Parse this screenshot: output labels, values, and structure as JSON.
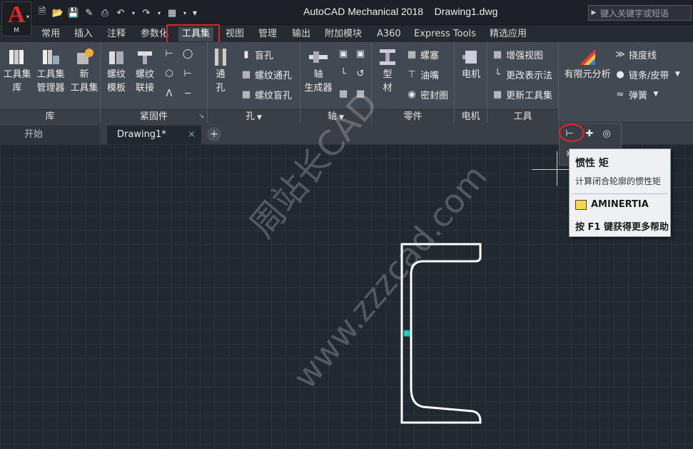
{
  "app": {
    "letter": "A",
    "sub": "M",
    "title": "AutoCAD Mechanical 2018    Drawing1.dwg"
  },
  "search": {
    "placeholder": "键入关键字或短语"
  },
  "ribbon_tabs": [
    "常用",
    "插入",
    "注释",
    "参数化",
    "工具集",
    "视图",
    "管理",
    "输出",
    "附加模块",
    "A360",
    "Express Tools",
    "精选应用"
  ],
  "active_tab": "工具集",
  "panels": {
    "lib": {
      "title": "库",
      "b1": "工具集",
      "b1b": "库",
      "b2": "工具集",
      "b2b": "管理器",
      "b3": "新",
      "b3b": "工具集"
    },
    "fast": {
      "title": "紧固件",
      "b1": "螺纹",
      "b1b": "模板",
      "b2": "螺纹",
      "b2b": "联接"
    },
    "hole": {
      "title": "孔",
      "b1": "通",
      "b1b": "孔",
      "s1": "盲孔",
      "s2": "螺纹通孔",
      "s3": "螺纹盲孔"
    },
    "shaft": {
      "title": "轴",
      "b1": "轴",
      "b1b": "生成器"
    },
    "parts": {
      "title": "零件",
      "b1": "型",
      "b1b": "材",
      "s1": "螺塞",
      "s2": "油嘴",
      "s3": "密封圈"
    },
    "motor": {
      "title": "电机",
      "b1": "电机"
    },
    "tools": {
      "title": "工具",
      "s1": "增强视图",
      "s2": "更改表示法",
      "s3": "更新工具集"
    },
    "calc": {
      "b1": "有限元分析",
      "s1": "挠度线",
      "s2": "链条/皮带",
      "s3": "弹簧"
    }
  },
  "doc_tabs": {
    "start": "开始",
    "current": "Drawing1*",
    "close": "×",
    "plus": "+"
  },
  "tooltip": {
    "title": "惯性 矩",
    "desc": "计算闭合轮廓的惯性矩",
    "command": "AMINERTIA",
    "help": "按 F1 键获得更多帮助"
  },
  "watermark": {
    "line1": "周站长CAD",
    "line2": "www.zzzcad.com"
  },
  "colors": {
    "canvas": "#212830",
    "ribbon": "#434952",
    "highlight": "#d8262c",
    "profile": "#ffffff",
    "grip": "#19d3d3"
  }
}
